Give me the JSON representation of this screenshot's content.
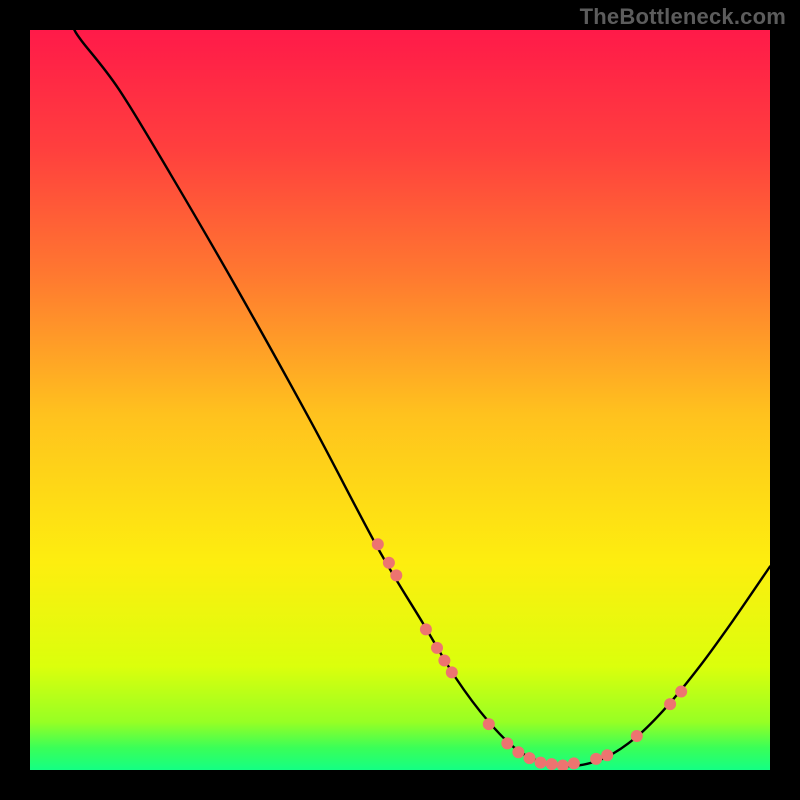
{
  "attribution": "TheBottleneck.com",
  "chart_data": {
    "type": "line",
    "xlim": [
      0,
      100
    ],
    "ylim": [
      0,
      100
    ],
    "background_gradient": {
      "stops": [
        {
          "offset": 0.0,
          "color": "#ff1a49"
        },
        {
          "offset": 0.16,
          "color": "#ff3f3e"
        },
        {
          "offset": 0.33,
          "color": "#ff7830"
        },
        {
          "offset": 0.52,
          "color": "#ffc21e"
        },
        {
          "offset": 0.72,
          "color": "#fdee0f"
        },
        {
          "offset": 0.86,
          "color": "#dbff0c"
        },
        {
          "offset": 0.935,
          "color": "#97ff24"
        },
        {
          "offset": 0.97,
          "color": "#3aff58"
        },
        {
          "offset": 1.0,
          "color": "#14ff84"
        }
      ]
    },
    "series": [
      {
        "name": "bottleneck-curve",
        "color": "#000000",
        "width": 2.4,
        "points": [
          {
            "x": 6.0,
            "y": 100.0
          },
          {
            "x": 7.0,
            "y": 98.5
          },
          {
            "x": 12.0,
            "y": 92.0
          },
          {
            "x": 19.0,
            "y": 80.5
          },
          {
            "x": 28.0,
            "y": 65.0
          },
          {
            "x": 38.0,
            "y": 47.0
          },
          {
            "x": 47.0,
            "y": 30.0
          },
          {
            "x": 53.0,
            "y": 20.0
          },
          {
            "x": 57.5,
            "y": 12.5
          },
          {
            "x": 62.0,
            "y": 6.5
          },
          {
            "x": 66.0,
            "y": 2.6
          },
          {
            "x": 70.0,
            "y": 0.8
          },
          {
            "x": 74.0,
            "y": 0.6
          },
          {
            "x": 78.0,
            "y": 1.8
          },
          {
            "x": 82.0,
            "y": 4.5
          },
          {
            "x": 86.0,
            "y": 8.5
          },
          {
            "x": 90.5,
            "y": 14.0
          },
          {
            "x": 95.0,
            "y": 20.2
          },
          {
            "x": 100.0,
            "y": 27.5
          }
        ]
      }
    ],
    "scatter_markers": {
      "color": "#ed7470",
      "radius": 6,
      "points": [
        {
          "x": 47.0,
          "y": 30.5
        },
        {
          "x": 48.5,
          "y": 28.0
        },
        {
          "x": 49.5,
          "y": 26.3
        },
        {
          "x": 53.5,
          "y": 19.0
        },
        {
          "x": 55.0,
          "y": 16.5
        },
        {
          "x": 56.0,
          "y": 14.8
        },
        {
          "x": 57.0,
          "y": 13.2
        },
        {
          "x": 62.0,
          "y": 6.2
        },
        {
          "x": 64.5,
          "y": 3.6
        },
        {
          "x": 66.0,
          "y": 2.4
        },
        {
          "x": 67.5,
          "y": 1.6
        },
        {
          "x": 69.0,
          "y": 1.0
        },
        {
          "x": 70.5,
          "y": 0.8
        },
        {
          "x": 72.0,
          "y": 0.6
        },
        {
          "x": 73.5,
          "y": 0.9
        },
        {
          "x": 76.5,
          "y": 1.5
        },
        {
          "x": 78.0,
          "y": 2.0
        },
        {
          "x": 82.0,
          "y": 4.6
        },
        {
          "x": 86.5,
          "y": 8.9
        },
        {
          "x": 88.0,
          "y": 10.6
        }
      ]
    }
  }
}
